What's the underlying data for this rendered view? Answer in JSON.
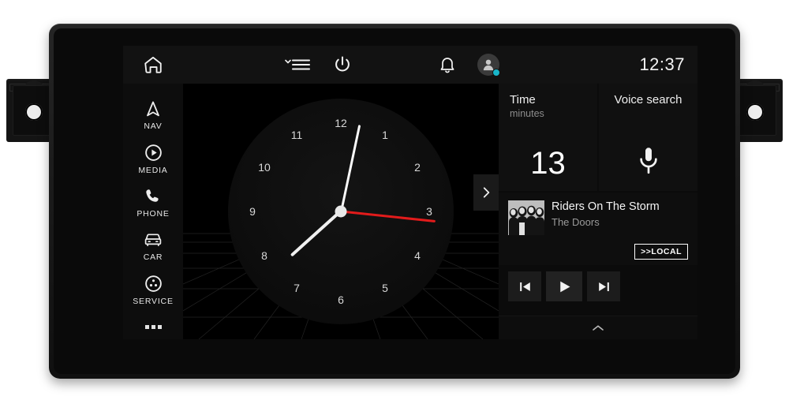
{
  "device": {
    "bracket_left": "mounting-bracket-left",
    "bracket_right": "mounting-bracket-right"
  },
  "topbar": {
    "home_icon": "home-icon",
    "menu_icon": "hamburger-menu-icon",
    "power_icon": "power-icon",
    "notification_icon": "bell-icon",
    "avatar_icon": "user-avatar-icon",
    "status_dot_color": "#19b6c9",
    "time": "12:37"
  },
  "sidebar": {
    "items": [
      {
        "label": "NAV",
        "icon": "navigation-arrow-icon"
      },
      {
        "label": "MEDIA",
        "icon": "play-circle-icon"
      },
      {
        "label": "PHONE",
        "icon": "phone-handset-icon"
      },
      {
        "label": "CAR",
        "icon": "car-front-icon"
      },
      {
        "label": "SERVICE",
        "icon": "service-circle-icon"
      }
    ],
    "more_label": "more-options"
  },
  "clock": {
    "numerals": [
      "12",
      "1",
      "2",
      "3",
      "4",
      "5",
      "6",
      "7",
      "8",
      "9",
      "10",
      "11"
    ],
    "hour_angle": 228,
    "minute_angle": 12,
    "second_angle": 96,
    "second_hand_color": "#e21b1b",
    "hand_color": "#fafafa"
  },
  "widgets": {
    "time": {
      "title": "Time",
      "subtitle": "minutes",
      "value": "13"
    },
    "voice": {
      "title": "Voice search",
      "icon": "microphone-icon"
    }
  },
  "now_playing": {
    "title": "Riders On The Storm",
    "artist": "The Doors",
    "source_badge": ">>LOCAL",
    "album_art": "album-art-thumbnail",
    "controls": {
      "previous": "skip-previous-icon",
      "play": "play-icon",
      "next": "skip-next-icon"
    }
  },
  "expand_button": {
    "icon": "chevron-right-icon"
  },
  "drawer": {
    "icon": "chevron-up-icon"
  }
}
